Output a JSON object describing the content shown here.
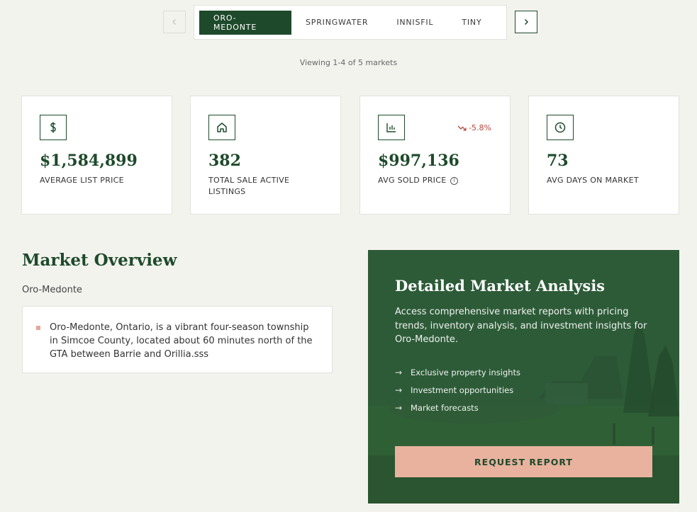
{
  "tabs": {
    "prev_icon": "chevron-left-icon",
    "next_icon": "chevron-right-icon",
    "items": [
      {
        "label": "ORO-MEDONTE",
        "active": true
      },
      {
        "label": "SPRINGWATER",
        "active": false
      },
      {
        "label": "INNISFIL",
        "active": false
      },
      {
        "label": "TINY",
        "active": false
      }
    ],
    "viewing": "Viewing 1-4 of 5 markets"
  },
  "stats": [
    {
      "icon": "dollar-icon",
      "value": "$1,584,899",
      "label": "AVERAGE LIST PRICE"
    },
    {
      "icon": "home-icon",
      "value": "382",
      "label": "TOTAL SALE ACTIVE LISTINGS"
    },
    {
      "icon": "bar-chart-icon",
      "value": "$997,136",
      "label": "AVG SOLD PRICE",
      "trend": "-5.8%",
      "trend_icon": "trending-down-icon"
    },
    {
      "icon": "clock-icon",
      "value": "73",
      "label": "AVG DAYS ON MARKET"
    }
  ],
  "overview": {
    "title": "Market Overview",
    "subtitle": "Oro-Medonte",
    "text": "Oro-Medonte, Ontario, is a vibrant four-season township in Simcoe County, located about 60 minutes north of the GTA between Barrie and Orillia.sss"
  },
  "analysis": {
    "title": "Detailed Market Analysis",
    "description": "Access comprehensive market reports with pricing trends, inventory analysis, and investment insights for Oro-Medonte.",
    "features": [
      "Exclusive property insights",
      "Investment opportunities",
      "Market forecasts"
    ],
    "button": "REQUEST REPORT"
  },
  "colors": {
    "brand_green": "#1e4a2b",
    "accent_peach": "#e8b29f",
    "trend_red": "#b5443a",
    "background": "#f3f3ee"
  }
}
